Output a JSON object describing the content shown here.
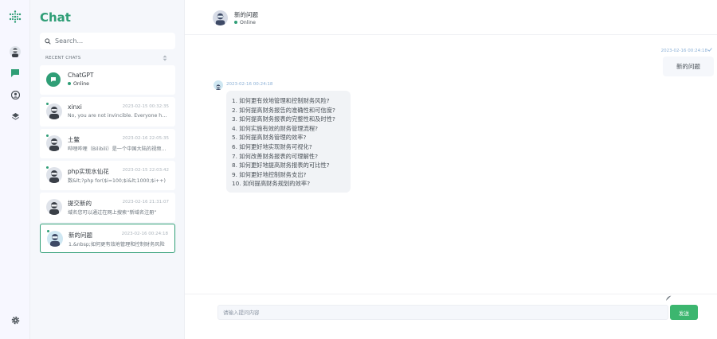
{
  "sidebar": {
    "title": "Chat",
    "search_placeholder": "Search...",
    "recent_label": "RECENT CHATS",
    "chats": [
      {
        "name": "ChatGPT",
        "status": "Online"
      },
      {
        "name": "xinxi",
        "time": "2023-02-15 00:32:35",
        "preview": "No, you are not invincible. Everyone has weaknesses"
      },
      {
        "name": "土鳖",
        "time": "2023-02-16 22:05:35",
        "preview": "哔哩哔哩（Bilibili）是一个中国大陆的视频网站"
      },
      {
        "name": "php实现水仙花",
        "time": "2023-02-15 22:03:42",
        "preview": "数&lt;?php for($i=100;$i&lt;1000;$i++)"
      },
      {
        "name": "提交新的",
        "time": "2023-02-16 21:31:07",
        "preview": "域名您可以通过在网上搜索“新域名注册”"
      },
      {
        "name": "新的问题",
        "time": "2023-02-16 00:24:18",
        "preview": "1.&nbsp;如何更有效地管理和控制财务风险"
      }
    ]
  },
  "header": {
    "name": "新的问题",
    "status": "Online"
  },
  "messages": {
    "sent": {
      "time": "2023-02-16 00:24:18",
      "text": "新的问题"
    },
    "received": {
      "time": "2023-02-16 00:24:18",
      "lines": [
        "1. 如何更有效地管理和控制财务风险?",
        "2. 如何提高财务报告的准确性和可信度?",
        "3. 如何提高财务报表的完整性和及时性?",
        "4. 如何实施有效的财务管理流程?",
        "5. 如何提高财务管理的效率?",
        "6. 如何更好地实现财务可视化?",
        "7. 如何改善财务报表的可理解性?",
        "8. 如何更好地提高财务报表的可比性?",
        "9. 如何更好地控制财务支出?",
        "10. 如何提高财务规划的效率?"
      ]
    }
  },
  "composer": {
    "placeholder": "请输入提问内容",
    "send_label": "发送"
  },
  "colors": {
    "accent": "#2f9e76",
    "send": "#3cb66f"
  },
  "icons": [
    "logo-icon",
    "avatar-icon",
    "chat-icon",
    "profile-icon",
    "layers-icon",
    "settings-icon",
    "search-icon"
  ]
}
